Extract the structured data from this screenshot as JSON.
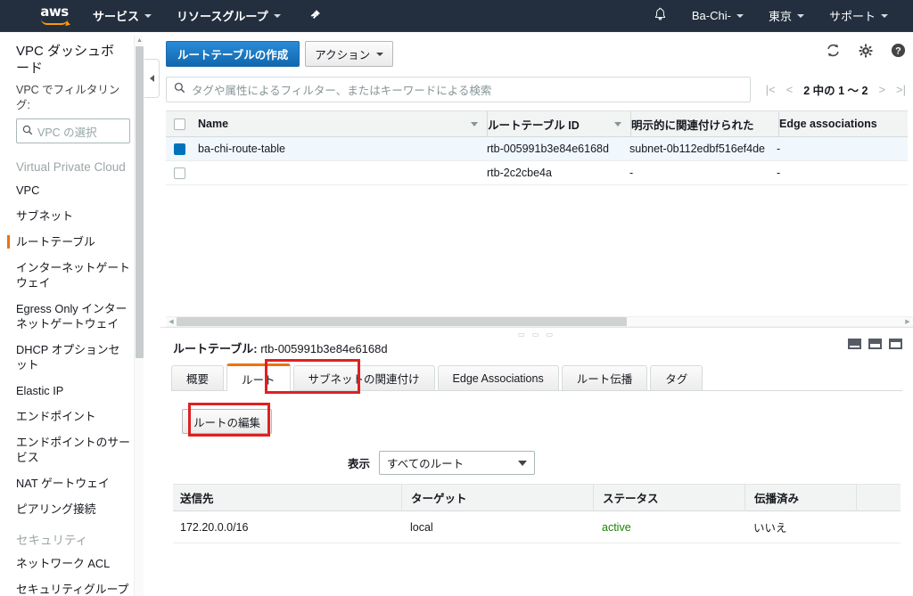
{
  "topnav": {
    "logo_text": "aws",
    "services_label": "サービス",
    "resource_groups_label": "リソースグループ",
    "pin_icon": "pin-icon",
    "bell_icon": "bell-icon",
    "account_label": "Ba-Chi-",
    "region_label": "東京",
    "support_label": "サポート"
  },
  "sidebar": {
    "dashboard_title": "VPC ダッシュボード",
    "filter_label": "VPC でフィルタリング:",
    "filter_placeholder": "VPC の選択",
    "search_icon": "search-icon",
    "group_vpc": "Virtual Private Cloud",
    "group_security": "セキュリティ",
    "items_vpc": [
      "VPC",
      "サブネット",
      "ルートテーブル",
      "インターネットゲートウェイ",
      "Egress Only インターネットゲートウェイ",
      "DHCP オプションセット",
      "Elastic IP",
      "エンドポイント",
      "エンドポイントのサービス",
      "NAT ゲートウェイ",
      "ピアリング接続"
    ],
    "items_security": [
      "ネットワーク ACL",
      "セキュリティグループ"
    ],
    "active_item": "ルートテーブル",
    "collapse_icon": "chevron-left-icon"
  },
  "toolbar": {
    "create_label": "ルートテーブルの作成",
    "actions_label": "アクション",
    "refresh_icon": "refresh-icon",
    "settings_icon": "gear-icon",
    "help_icon": "help-icon"
  },
  "search": {
    "placeholder": "タグや属性によるフィルター、またはキーワードによる検索",
    "icon": "search-icon"
  },
  "pager": {
    "first_icon": "first-page-icon",
    "prev_icon": "prev-page-icon",
    "count_label": "2 中の 1 〜 2",
    "next_icon": "next-page-icon",
    "last_icon": "last-page-icon"
  },
  "main_table": {
    "columns": [
      "Name",
      "ルートテーブル ID",
      "明示的に関連付けられた",
      "Edge associations"
    ],
    "rows": [
      {
        "selected": true,
        "name": "ba-chi-route-table",
        "route_table_id": "rtb-005991b3e84e6168d",
        "explicit_association": "subnet-0b112edbf516ef4de",
        "edge_associations": "-"
      },
      {
        "selected": false,
        "name": "",
        "route_table_id": "rtb-2c2cbe4a",
        "explicit_association": "-",
        "edge_associations": "-"
      }
    ]
  },
  "detail": {
    "title_label": "ルートテーブル:",
    "title_value": "rtb-005991b3e84e6168d",
    "pane_size_icons": [
      "pane-small-icon",
      "pane-medium-icon",
      "pane-large-icon"
    ],
    "tabs": [
      {
        "label": "概要",
        "active": false
      },
      {
        "label": "ルート",
        "active": true
      },
      {
        "label": "サブネットの関連付け",
        "active": false
      },
      {
        "label": "Edge Associations",
        "active": false
      },
      {
        "label": "ルート伝播",
        "active": false
      },
      {
        "label": "タグ",
        "active": false
      }
    ],
    "edit_routes_label": "ルートの編集",
    "display_label": "表示",
    "display_value": "すべてのルート",
    "routes_columns": [
      "送信先",
      "ターゲット",
      "ステータス",
      "伝播済み"
    ],
    "routes": [
      {
        "destination": "172.20.0.0/16",
        "target": "local",
        "status": "active",
        "propagated": "いいえ"
      }
    ]
  },
  "annotations": {
    "highlight_color": "#e02020",
    "highlight_tab": "ルート",
    "highlight_button": "ルートの編集"
  }
}
